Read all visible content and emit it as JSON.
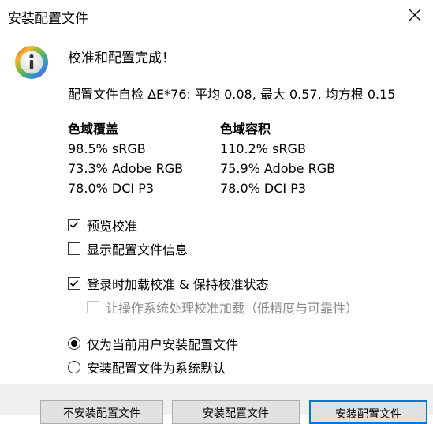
{
  "window": {
    "title": "安装配置文件"
  },
  "headline": "校准和配置完成！",
  "summary": "配置文件自检 ΔE*76: 平均 0.08, 最大 0.57, 均方根 0.15",
  "gamut_coverage": {
    "heading": "色域覆盖",
    "rows": [
      "98.5% sRGB",
      "73.3% Adobe RGB",
      "78.0% DCI P3"
    ]
  },
  "gamut_volume": {
    "heading": "色域容积",
    "rows": [
      "110.2% sRGB",
      "75.9% Adobe RGB",
      "78.0% DCI P3"
    ]
  },
  "options": {
    "preview_calibration": {
      "label": "预览校准",
      "checked": true
    },
    "show_profile_info": {
      "label": "显示配置文件信息",
      "checked": false
    },
    "load_on_login": {
      "label": "登录时加载校准 & 保持校准状态",
      "checked": true
    },
    "let_os_handle": {
      "label": "让操作系统处理校准加载（低精度与可靠性）",
      "checked": false,
      "disabled": true
    }
  },
  "install_scope": {
    "current_user": {
      "label": "仅为当前用户安装配置文件",
      "selected": true
    },
    "system_default": {
      "label": "安装配置文件为系统默认",
      "selected": false
    }
  },
  "buttons": [
    "不安装配置文件",
    "安装配置文件",
    "安装配置文件"
  ],
  "icons": {
    "close": "close-icon",
    "info": "info-icon",
    "check": "checkmark-icon"
  },
  "colors": {
    "button_focus_border": "#0078d7",
    "footer_bg": "#f0f0f0"
  }
}
